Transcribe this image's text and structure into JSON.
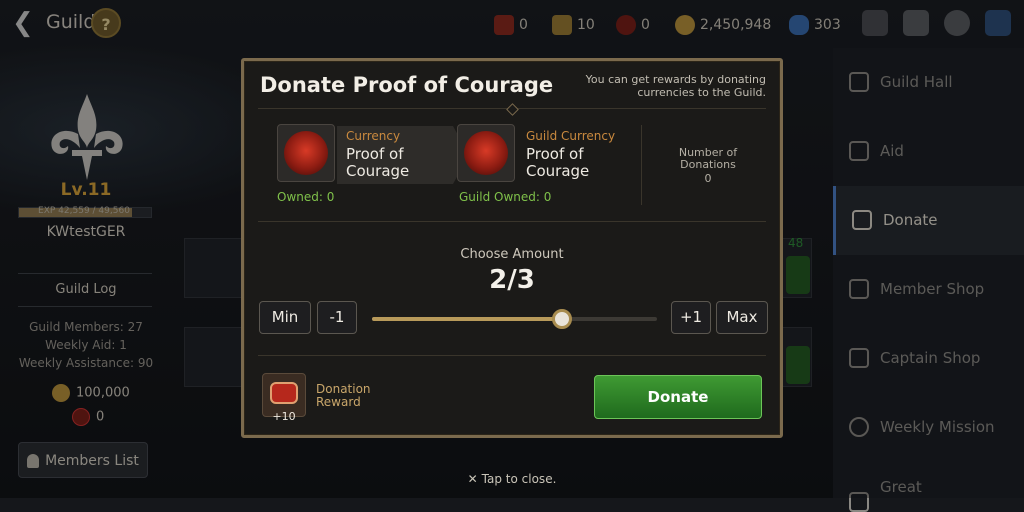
{
  "topbar": {
    "title": "Guild",
    "help_label": "?",
    "currencies": [
      {
        "icon": "ring-token-icon",
        "value": "0"
      },
      {
        "icon": "guild-box-icon",
        "value": "10"
      },
      {
        "icon": "proof-of-courage-icon",
        "value": "0"
      },
      {
        "icon": "gold-coin-icon",
        "value": "2,450,948"
      },
      {
        "icon": "crystal-icon",
        "value": "303"
      }
    ]
  },
  "left": {
    "level": "Lv.11",
    "exp": "EXP 42,559 / 49,560",
    "exp_fraction": 0.8587,
    "guild_name": "KWtestGER",
    "guild_log": "Guild Log",
    "members": "Guild Members: 27",
    "weekly_aid": "Weekly Aid: 1",
    "weekly_assistance": "Weekly Assistance: 90",
    "gold": "100,000",
    "proof": "0",
    "members_button": "Members List"
  },
  "nav": {
    "items": [
      {
        "label": "Guild Hall",
        "icon": "guild-hall-icon"
      },
      {
        "label": "Aid",
        "icon": "aid-icon"
      },
      {
        "label": "Donate",
        "icon": "donate-icon"
      },
      {
        "label": "Member Shop",
        "icon": "scales-icon"
      },
      {
        "label": "Captain Shop",
        "icon": "scales-icon"
      },
      {
        "label": "Weekly Mission",
        "icon": "target-icon"
      },
      {
        "label": "Great",
        "icon": "castle-icon"
      }
    ],
    "active_index": 2
  },
  "background_text": {
    "count": "48"
  },
  "modal": {
    "title": "Donate Proof of Courage",
    "note": "You can get rewards by donating currencies to the Guild.",
    "currency_label": "Currency",
    "currency_name": "Proof of Courage",
    "owned": "Owned: 0",
    "guild_currency_label": "Guild Currency",
    "guild_currency_name": "Proof of Courage",
    "guild_owned": "Guild Owned: 0",
    "num_donations_label": "Number of Donations",
    "num_donations_value": "0",
    "choose_label": "Choose Amount",
    "amount": "2/3",
    "amount_current": 2,
    "amount_max": 3,
    "min_label": "Min",
    "minus_label": "-1",
    "plus_label": "+1",
    "max_label": "Max",
    "reward_label": "Donation Reward",
    "reward_qty": "+10",
    "donate_label": "Donate"
  },
  "footer": {
    "tap_close": "Tap to close."
  }
}
